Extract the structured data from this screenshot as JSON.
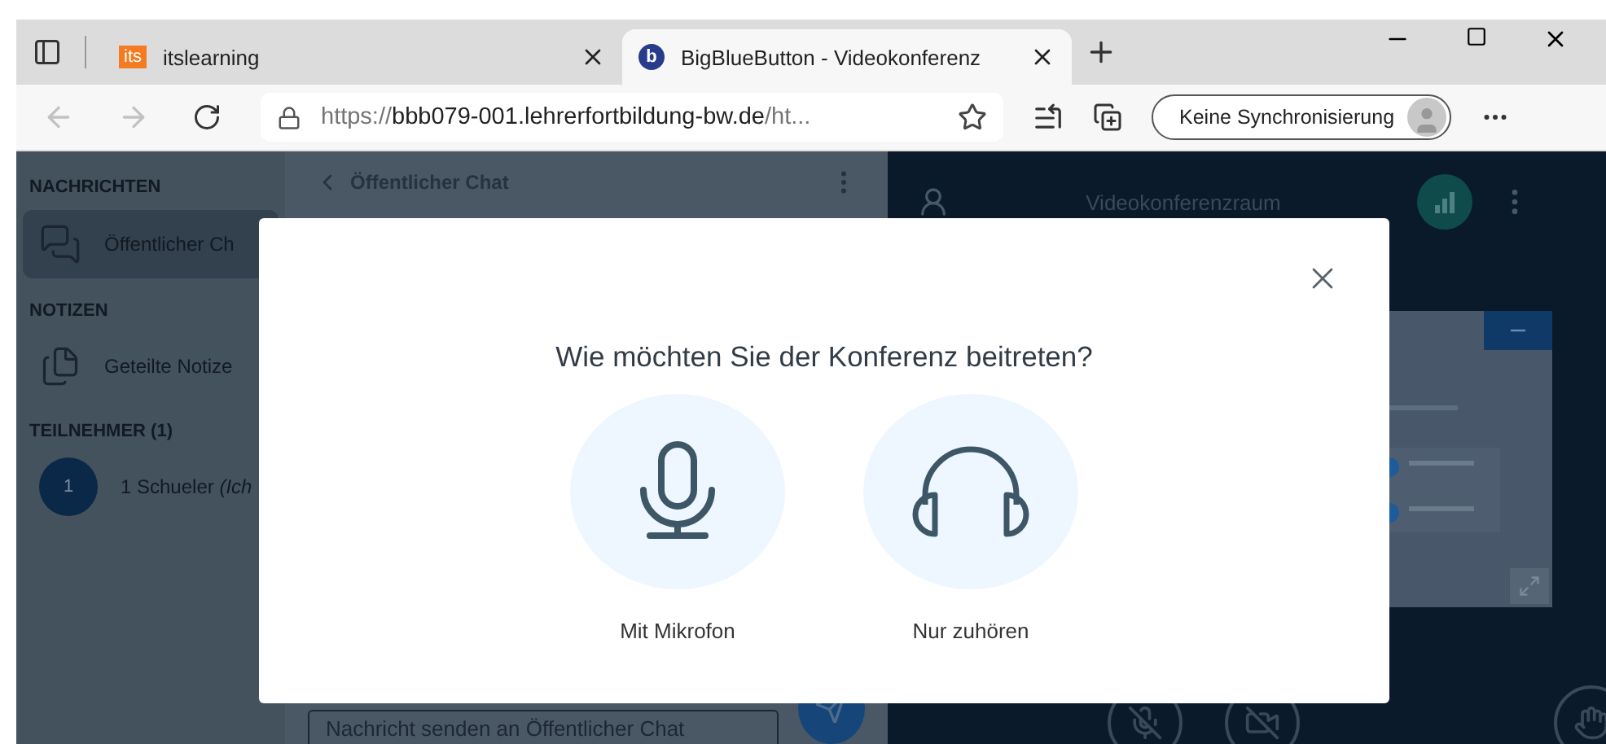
{
  "browser": {
    "tabs": [
      {
        "logo": "its",
        "kind": "square",
        "title": "itslearning",
        "selected": false
      },
      {
        "logo": "b",
        "kind": "circle",
        "title": "BigBlueButton - Videokonferenz",
        "selected": true
      }
    ],
    "nav": [
      {
        "kind": "back",
        "disabled": true
      },
      {
        "kind": "forward",
        "disabled": true
      },
      {
        "kind": "reload",
        "disabled": false
      }
    ],
    "address": {
      "scheme": "https://",
      "host": "bbb079-001.lehrerfortbildung-bw.de",
      "path": "/ht..."
    },
    "sync_button": "Keine Synchronisierung"
  },
  "sidebar": {
    "sections": [
      {
        "heading": "NACHRICHTEN",
        "items": [
          {
            "kind": "chat",
            "label": "Öffentlicher Ch",
            "selected": true
          }
        ]
      },
      {
        "heading": "NOTIZEN",
        "items": [
          {
            "kind": "notes",
            "label": "Geteilte Notize",
            "selected": false
          }
        ]
      },
      {
        "heading": "TEILNEHMER (1)",
        "items": [
          {
            "kind": "user",
            "avatar": "1",
            "label": "1 Schueler *(Ich*",
            "selected": false
          }
        ]
      }
    ]
  },
  "chat": {
    "title": "Öffentlicher Chat",
    "placeholder": "Nachricht senden an Öffentlicher Chat"
  },
  "main": {
    "title": "Videokonferenzraum",
    "controls": [
      {
        "kind": "mic_off"
      },
      {
        "kind": "video_off"
      },
      {
        "kind": "hand"
      }
    ]
  },
  "dialog": {
    "question": "Wie möchten Sie der Konferenz beitreten?",
    "options": [
      {
        "kind": "microphone",
        "label": "Mit Mikrofon"
      },
      {
        "kind": "headphones",
        "label": "Nur zuhören"
      }
    ]
  }
}
